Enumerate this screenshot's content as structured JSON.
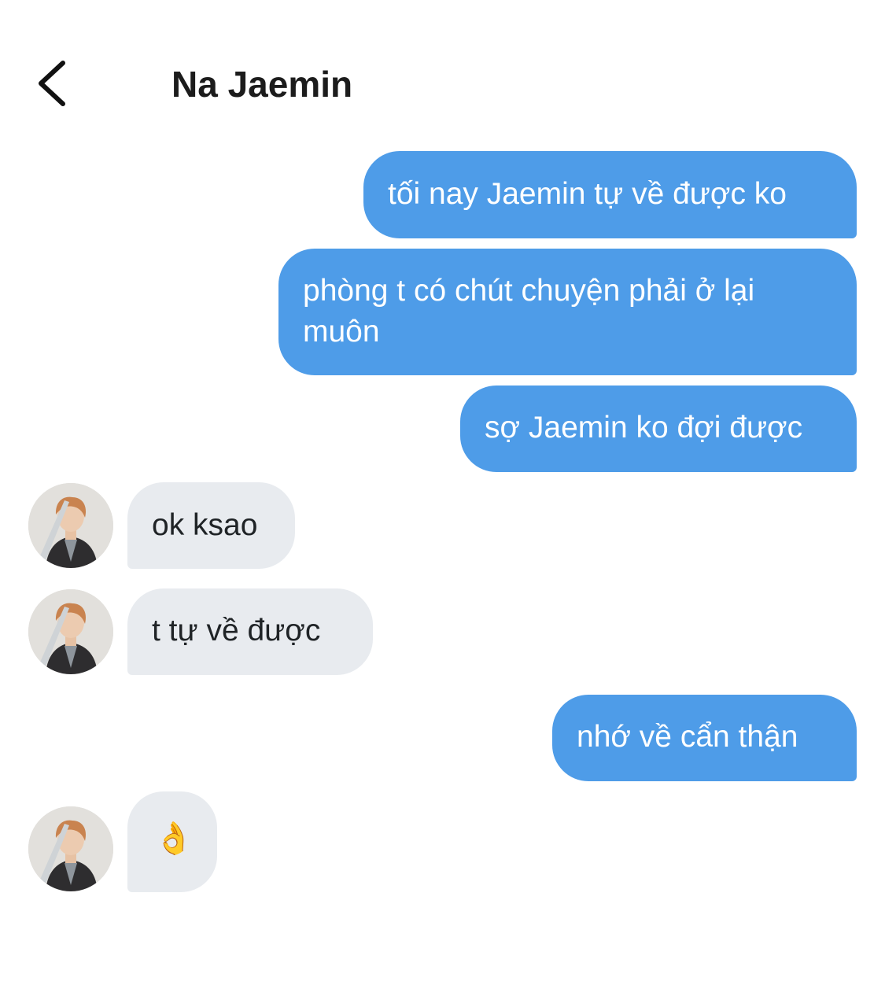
{
  "header": {
    "back_icon": "chevron-left-icon",
    "title": "Na Jaemin"
  },
  "colors": {
    "outgoing_bubble": "#4e9ce8",
    "incoming_bubble": "#e8ebef",
    "outgoing_text": "#ffffff",
    "incoming_text": "#1f2326"
  },
  "messages": [
    {
      "direction": "out",
      "lines": [
        "tối nay Jaemin tự về được ko"
      ]
    },
    {
      "direction": "out",
      "lines": [
        "phòng t có chút chuyện phải ở lại",
        "muôn"
      ]
    },
    {
      "direction": "out",
      "lines": [
        "sợ Jaemin ko đợi được"
      ]
    },
    {
      "direction": "in",
      "avatar": "contact-avatar",
      "lines": [
        "ok ksao"
      ]
    },
    {
      "direction": "in",
      "avatar": "contact-avatar",
      "lines": [
        "t tự về được"
      ]
    },
    {
      "direction": "out",
      "lines": [
        "nhớ về cẩn thận"
      ]
    },
    {
      "direction": "in",
      "avatar": "contact-avatar",
      "lines": [
        "👌"
      ],
      "emoji": "ok-hand-emoji"
    }
  ]
}
